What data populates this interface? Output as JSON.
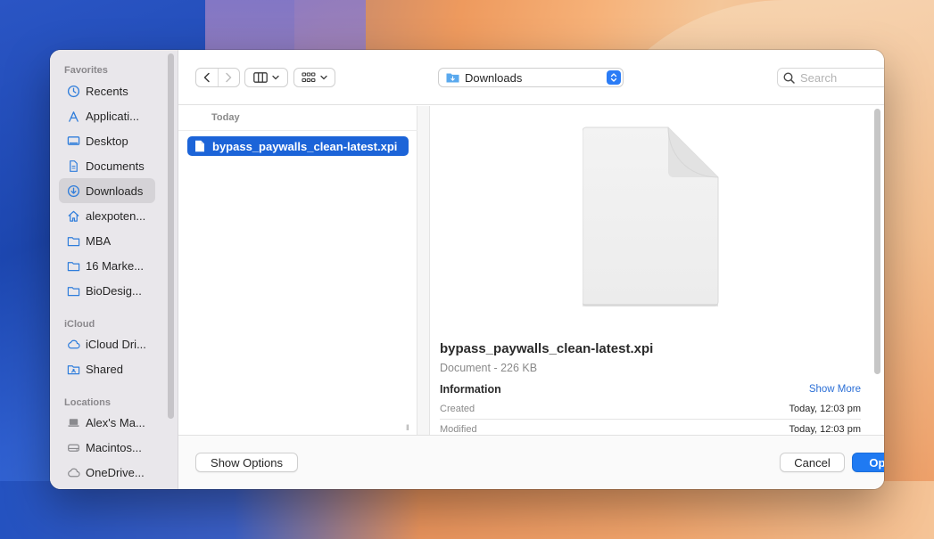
{
  "sidebar": {
    "favorites_label": "Favorites",
    "favorites": [
      {
        "label": "Recents",
        "icon": "clock-icon"
      },
      {
        "label": "Applicati...",
        "icon": "applications-icon"
      },
      {
        "label": "Desktop",
        "icon": "desktop-icon"
      },
      {
        "label": "Documents",
        "icon": "document-icon"
      },
      {
        "label": "Downloads",
        "icon": "download-icon",
        "selected": true
      },
      {
        "label": "alexpoten...",
        "icon": "home-icon"
      },
      {
        "label": "MBA",
        "icon": "folder-icon"
      },
      {
        "label": "16 Marke...",
        "icon": "folder-icon"
      },
      {
        "label": "BioDesig...",
        "icon": "folder-icon"
      }
    ],
    "icloud_label": "iCloud",
    "icloud": [
      {
        "label": "iCloud Dri...",
        "icon": "cloud-icon"
      },
      {
        "label": "Shared",
        "icon": "shared-folder-icon"
      }
    ],
    "locations_label": "Locations",
    "locations": [
      {
        "label": "Alex's Ma...",
        "icon": "laptop-icon"
      },
      {
        "label": "Macintos...",
        "icon": "disk-icon"
      },
      {
        "label": "OneDrive...",
        "icon": "cloud-icon"
      }
    ]
  },
  "toolbar": {
    "location": "Downloads",
    "search_placeholder": "Search"
  },
  "browser": {
    "group_header": "Today",
    "files": [
      {
        "name": "bypass_paywalls_clean-latest.xpi",
        "selected": true
      }
    ]
  },
  "preview": {
    "file_name": "bypass_paywalls_clean-latest.xpi",
    "kind": "Document - 226 KB",
    "info_label": "Information",
    "show_more": "Show More",
    "rows": [
      {
        "label": "Created",
        "value": "Today, 12:03 pm"
      },
      {
        "label": "Modified",
        "value": "Today, 12:03 pm"
      }
    ]
  },
  "footer": {
    "show_options": "Show Options",
    "cancel": "Cancel",
    "open": "Open"
  },
  "colors": {
    "accent": "#1f7af2",
    "selection": "#1c64d8",
    "sidebar_icon": "#2f7ddb"
  }
}
